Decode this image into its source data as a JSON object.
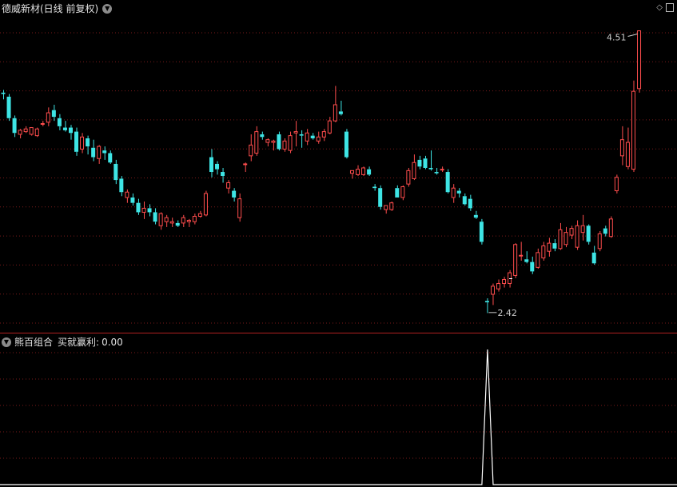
{
  "header": {
    "title": "德威新材(日线 前复权)",
    "indicator": "熊百组合",
    "indicator_series": "买就赢利:",
    "indicator_value": "0.00"
  },
  "annotations": {
    "high_label": "4.51",
    "low_label": "2.42"
  },
  "colors": {
    "up": "#ff4d4d",
    "down": "#3ee5e5",
    "grid": "#7a1a1a",
    "divider": "#b02020",
    "signal": "#ffffff"
  },
  "chart_data": [
    {
      "type": "candlestick",
      "name": "price",
      "ylim": [
        2.3,
        4.65
      ],
      "annotations": [
        {
          "value": 4.51,
          "label": "4.51"
        },
        {
          "value": 2.42,
          "label": "2.42"
        }
      ],
      "ohlc": [
        [
          4.05,
          4.07,
          4.0,
          4.04
        ],
        [
          4.02,
          4.04,
          3.84,
          3.86
        ],
        [
          3.86,
          3.88,
          3.72,
          3.75
        ],
        [
          3.74,
          3.78,
          3.71,
          3.77
        ],
        [
          3.76,
          3.8,
          3.75,
          3.78
        ],
        [
          3.74,
          3.79,
          3.73,
          3.79
        ],
        [
          3.73,
          3.79,
          3.72,
          3.78
        ],
        [
          3.82,
          3.84,
          3.8,
          3.82
        ],
        [
          3.83,
          3.94,
          3.8,
          3.9
        ],
        [
          3.92,
          3.96,
          3.84,
          3.87
        ],
        [
          3.86,
          3.89,
          3.77,
          3.8
        ],
        [
          3.79,
          3.84,
          3.76,
          3.77
        ],
        [
          3.79,
          3.81,
          3.7,
          3.75
        ],
        [
          3.76,
          3.79,
          3.58,
          3.61
        ],
        [
          3.63,
          3.75,
          3.6,
          3.72
        ],
        [
          3.71,
          3.73,
          3.59,
          3.65
        ],
        [
          3.64,
          3.7,
          3.54,
          3.57
        ],
        [
          3.56,
          3.66,
          3.52,
          3.65
        ],
        [
          3.62,
          3.65,
          3.55,
          3.6
        ],
        [
          3.6,
          3.62,
          3.52,
          3.53
        ],
        [
          3.52,
          3.55,
          3.37,
          3.4
        ],
        [
          3.41,
          3.43,
          3.28,
          3.31
        ],
        [
          3.27,
          3.33,
          3.23,
          3.31
        ],
        [
          3.27,
          3.3,
          3.21,
          3.23
        ],
        [
          3.23,
          3.26,
          3.14,
          3.16
        ],
        [
          3.16,
          3.24,
          3.11,
          3.19
        ],
        [
          3.19,
          3.22,
          3.13,
          3.16
        ],
        [
          3.16,
          3.19,
          3.07,
          3.09
        ],
        [
          3.06,
          3.16,
          3.03,
          3.15
        ],
        [
          3.09,
          3.14,
          3.05,
          3.12
        ],
        [
          3.08,
          3.12,
          3.05,
          3.09
        ],
        [
          3.08,
          3.1,
          3.05,
          3.06
        ],
        [
          3.08,
          3.14,
          3.05,
          3.12
        ],
        [
          3.09,
          3.11,
          3.05,
          3.1
        ],
        [
          3.09,
          3.15,
          3.07,
          3.13
        ],
        [
          3.13,
          3.17,
          3.12,
          3.15
        ],
        [
          3.14,
          3.32,
          3.13,
          3.3
        ],
        [
          3.57,
          3.63,
          3.42,
          3.46
        ],
        [
          3.52,
          3.54,
          3.44,
          3.48
        ],
        [
          3.46,
          3.49,
          3.38,
          3.43
        ],
        [
          3.34,
          3.4,
          3.3,
          3.38
        ],
        [
          3.32,
          3.34,
          3.24,
          3.27
        ],
        [
          3.12,
          3.3,
          3.09,
          3.26
        ],
        [
          3.52,
          3.53,
          3.46,
          3.52
        ],
        [
          3.58,
          3.74,
          3.54,
          3.66
        ],
        [
          3.6,
          3.8,
          3.58,
          3.76
        ],
        [
          3.74,
          3.76,
          3.7,
          3.72
        ],
        [
          3.68,
          3.71,
          3.65,
          3.7
        ],
        [
          3.68,
          3.7,
          3.62,
          3.69
        ],
        [
          3.74,
          3.76,
          3.62,
          3.63
        ],
        [
          3.63,
          3.71,
          3.61,
          3.69
        ],
        [
          3.62,
          3.76,
          3.6,
          3.73
        ],
        [
          3.75,
          3.84,
          3.65,
          3.76
        ],
        [
          3.74,
          3.77,
          3.64,
          3.73
        ],
        [
          3.69,
          3.78,
          3.66,
          3.75
        ],
        [
          3.73,
          3.75,
          3.7,
          3.71
        ],
        [
          3.69,
          3.76,
          3.67,
          3.72
        ],
        [
          3.72,
          3.78,
          3.69,
          3.76
        ],
        [
          3.75,
          3.87,
          3.74,
          3.84
        ],
        [
          3.84,
          4.1,
          3.83,
          3.96
        ],
        [
          3.91,
          3.99,
          3.88,
          3.89
        ],
        [
          3.76,
          3.78,
          3.56,
          3.57
        ],
        [
          3.45,
          3.47,
          3.41,
          3.47
        ],
        [
          3.44,
          3.51,
          3.43,
          3.48
        ],
        [
          3.44,
          3.5,
          3.43,
          3.49
        ],
        [
          3.48,
          3.5,
          3.43,
          3.44
        ],
        [
          3.35,
          3.37,
          3.32,
          3.34
        ],
        [
          3.34,
          3.36,
          3.18,
          3.2
        ],
        [
          3.18,
          3.21,
          3.15,
          3.21
        ],
        [
          3.18,
          3.24,
          3.17,
          3.23
        ],
        [
          3.34,
          3.36,
          3.27,
          3.27
        ],
        [
          3.27,
          3.36,
          3.25,
          3.35
        ],
        [
          3.37,
          3.49,
          3.35,
          3.47
        ],
        [
          3.41,
          3.59,
          3.4,
          3.53
        ],
        [
          3.55,
          3.58,
          3.48,
          3.5
        ],
        [
          3.56,
          3.58,
          3.48,
          3.49
        ],
        [
          3.49,
          3.62,
          3.47,
          3.48
        ],
        [
          3.46,
          3.49,
          3.44,
          3.45
        ],
        [
          3.48,
          3.5,
          3.46,
          3.48
        ],
        [
          3.46,
          3.48,
          3.3,
          3.31
        ],
        [
          3.27,
          3.37,
          3.23,
          3.34
        ],
        [
          3.32,
          3.34,
          3.27,
          3.3
        ],
        [
          3.28,
          3.3,
          3.21,
          3.22
        ],
        [
          3.26,
          3.29,
          3.17,
          3.19
        ],
        [
          3.14,
          3.17,
          3.11,
          3.12
        ],
        [
          3.09,
          3.11,
          2.92,
          2.94
        ],
        [
          2.5,
          2.52,
          2.41,
          2.49
        ],
        [
          2.55,
          2.63,
          2.47,
          2.61
        ],
        [
          2.59,
          2.66,
          2.57,
          2.63
        ],
        [
          2.63,
          2.68,
          2.6,
          2.66
        ],
        [
          2.63,
          2.73,
          2.6,
          2.71
        ],
        [
          2.69,
          2.93,
          2.67,
          2.92
        ],
        [
          2.84,
          2.94,
          2.8,
          2.84
        ],
        [
          2.81,
          2.87,
          2.78,
          2.79
        ],
        [
          2.79,
          2.83,
          2.7,
          2.72
        ],
        [
          2.75,
          2.89,
          2.74,
          2.86
        ],
        [
          2.82,
          2.94,
          2.8,
          2.91
        ],
        [
          2.87,
          2.97,
          2.83,
          2.93
        ],
        [
          2.93,
          2.96,
          2.87,
          2.89
        ],
        [
          2.89,
          3.08,
          2.88,
          3.03
        ],
        [
          2.92,
          3.05,
          2.9,
          3.01
        ],
        [
          2.99,
          3.06,
          2.96,
          3.04
        ],
        [
          2.9,
          3.1,
          2.88,
          3.06
        ],
        [
          3.01,
          3.14,
          2.95,
          3.06
        ],
        [
          3.06,
          3.07,
          2.92,
          2.94
        ],
        [
          2.86,
          2.91,
          2.77,
          2.78
        ],
        [
          2.89,
          3.02,
          2.87,
          3.0
        ],
        [
          3.04,
          3.06,
          2.98,
          3.0
        ],
        [
          2.98,
          3.13,
          2.97,
          3.11
        ],
        [
          3.32,
          3.44,
          3.3,
          3.42
        ],
        [
          3.58,
          3.8,
          3.51,
          3.7
        ],
        [
          3.5,
          3.79,
          3.48,
          3.68
        ],
        [
          3.48,
          4.14,
          3.46,
          4.06
        ],
        [
          4.08,
          4.51,
          4.05,
          4.51
        ]
      ]
    },
    {
      "type": "line",
      "name": "买就赢利",
      "ylim": [
        0,
        1
      ],
      "spikes": [
        {
          "index": 86,
          "value": 1
        }
      ]
    }
  ]
}
